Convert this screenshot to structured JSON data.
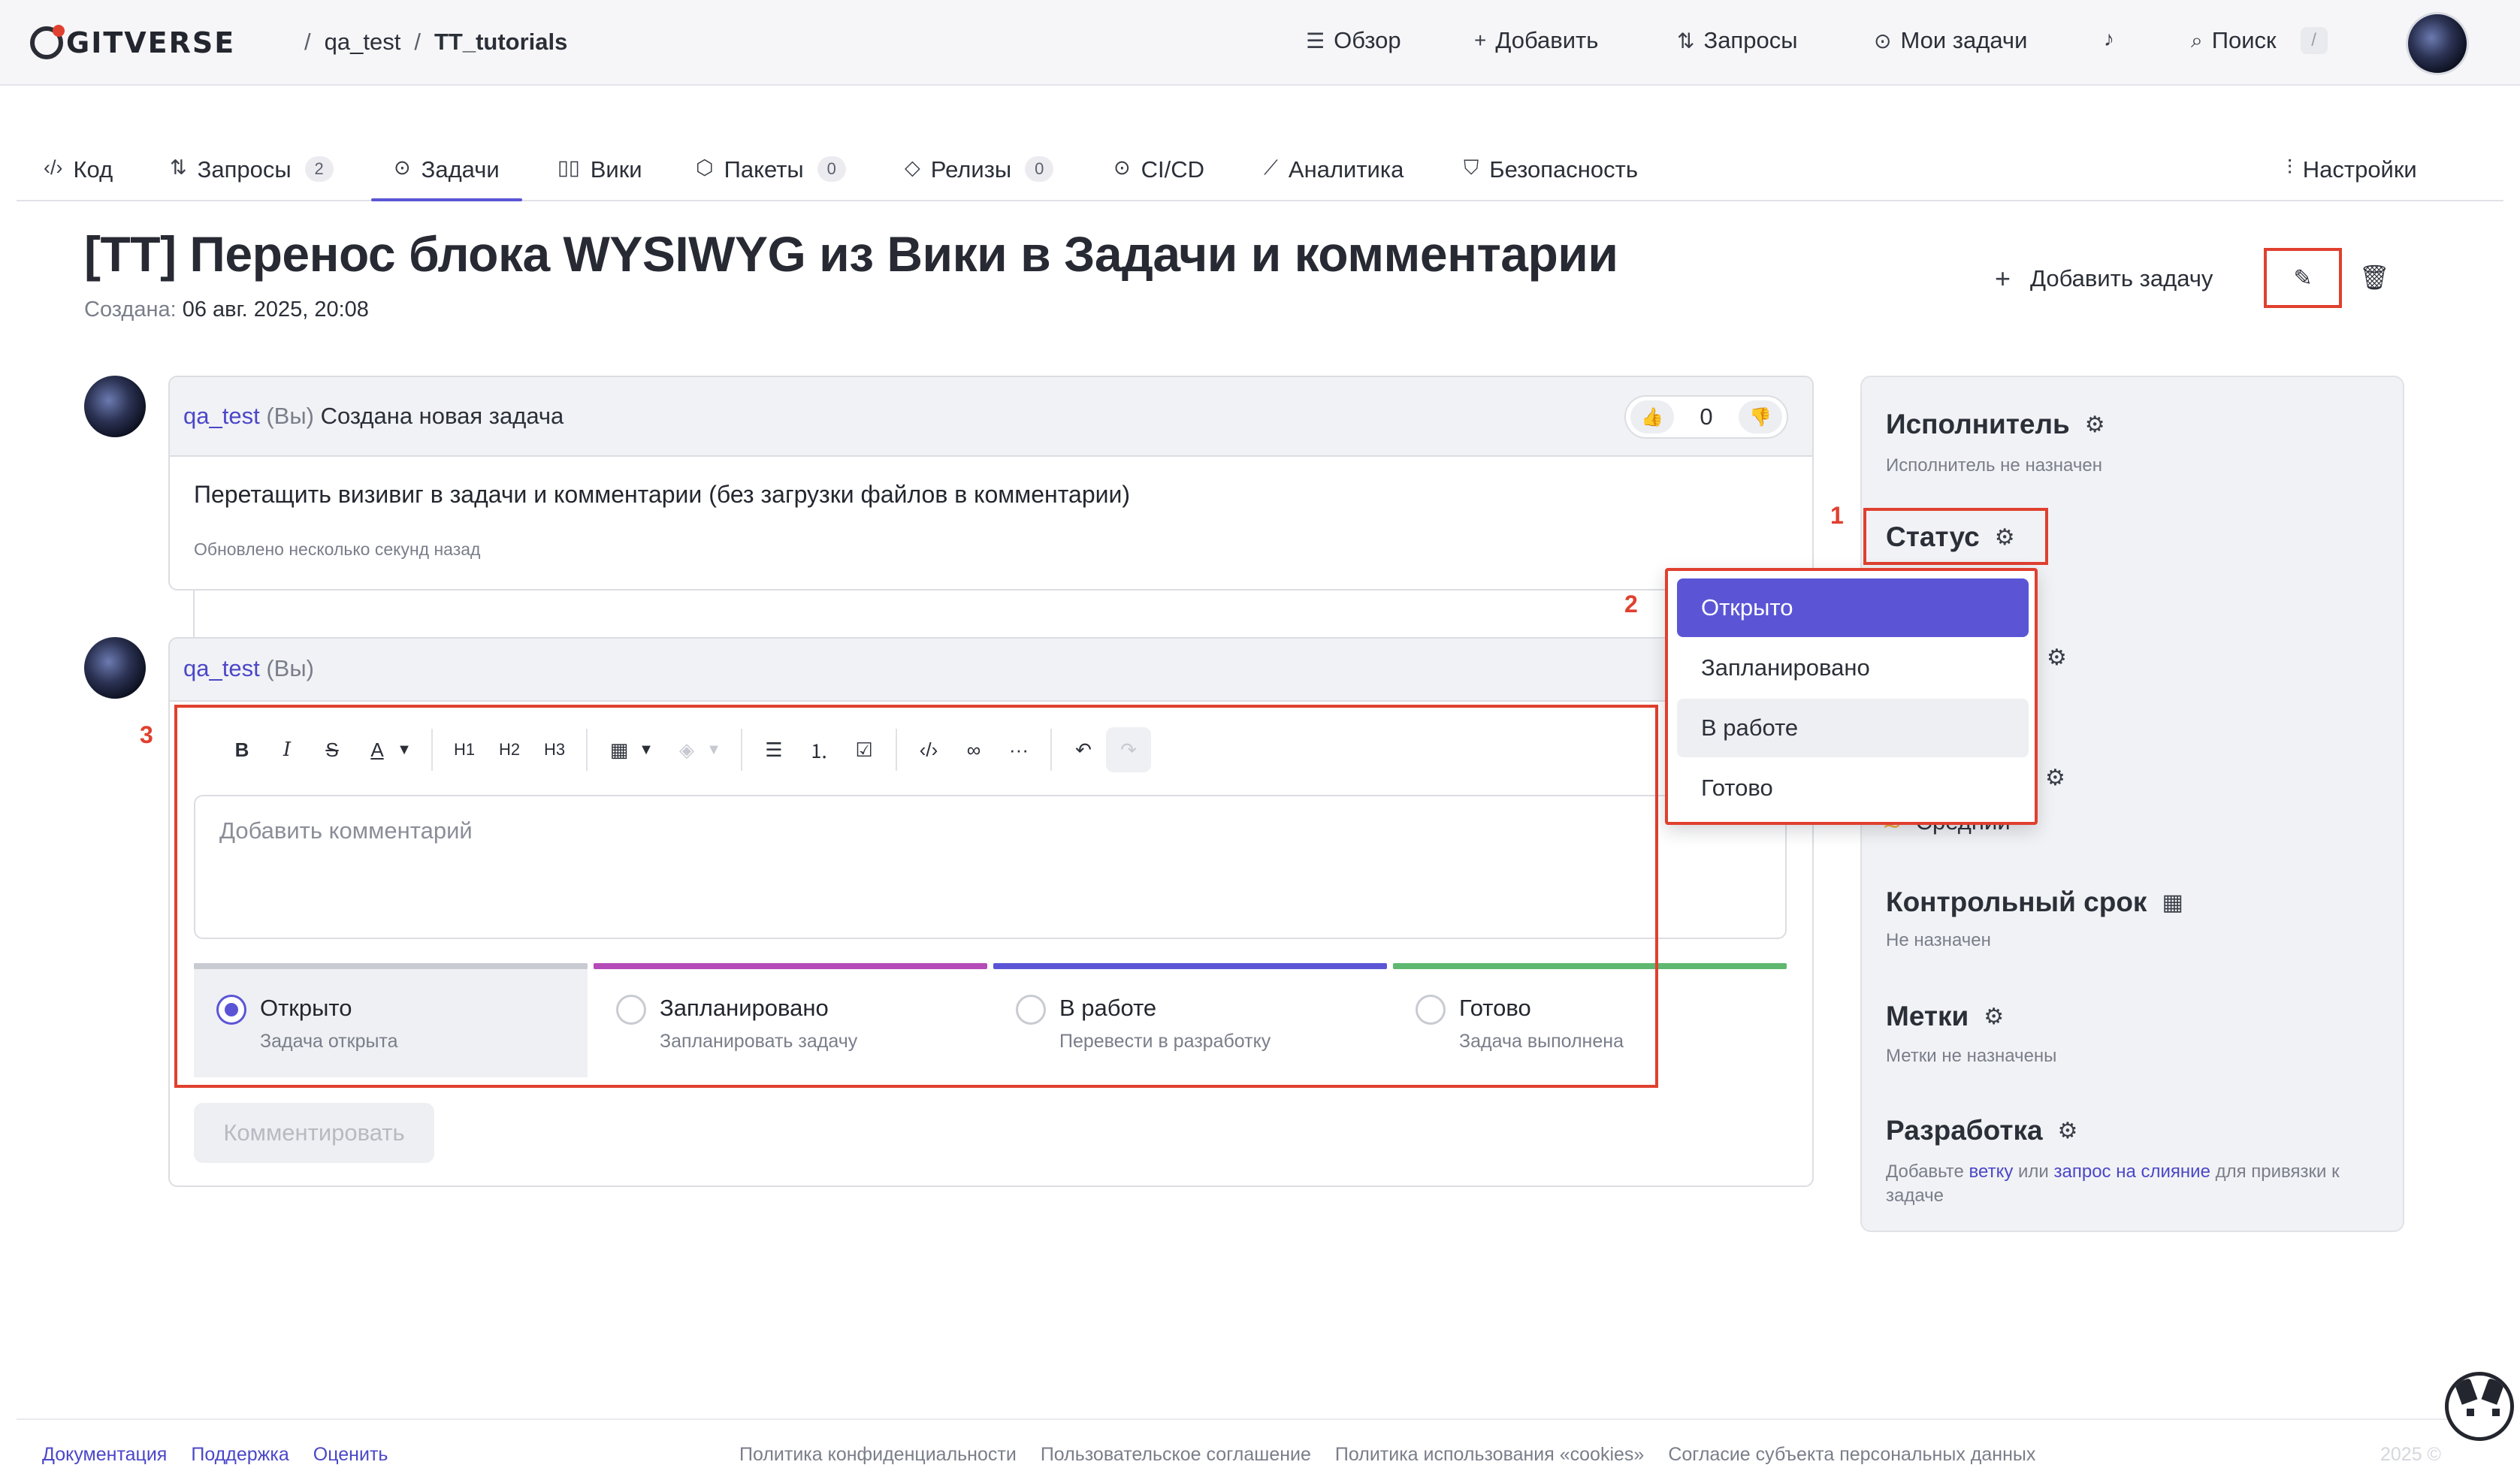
{
  "topbar": {
    "logo_text": "GITVERSE",
    "breadcrumb": {
      "owner": "qa_test",
      "separator": "/",
      "repo": "TT_tutorials"
    },
    "nav": {
      "overview": "Обзор",
      "add": "Добавить",
      "requests": "Запросы",
      "my_tasks": "Мои задачи",
      "search": "Поиск",
      "search_shortcut": "/"
    }
  },
  "tabs": [
    {
      "label": "Код",
      "icon": "code-icon"
    },
    {
      "label": "Запросы",
      "count": "2",
      "icon": "merge-icon"
    },
    {
      "label": "Задачи",
      "icon": "issue-icon",
      "active": true
    },
    {
      "label": "Вики",
      "icon": "book-icon"
    },
    {
      "label": "Пакеты",
      "count": "0",
      "icon": "package-icon"
    },
    {
      "label": "Релизы",
      "count": "0",
      "icon": "tag-icon"
    },
    {
      "label": "CI/CD",
      "icon": "ci-icon"
    },
    {
      "label": "Аналитика",
      "icon": "chart-icon"
    },
    {
      "label": "Безопасность",
      "icon": "shield-icon"
    },
    {
      "label": "Настройки",
      "icon": "settings-icon"
    }
  ],
  "issue": {
    "title": "[TT] Перенос блока WYSIWYG из Вики в Задачи и комментарии",
    "created_label": "Создана:",
    "created_value": "06 авг. 2025, 20:08",
    "add_task": "Добавить задачу"
  },
  "event": {
    "user": "qa_test",
    "you": "(Вы)",
    "action": "Создана новая задача",
    "reaction_count": "0",
    "body": "Перетащить визивиг в задачи и комментарии (без загрузки файлов в комментарии)",
    "updated": "Обновлено несколько секунд назад"
  },
  "composer": {
    "user": "qa_test",
    "you": "(Вы)",
    "placeholder": "Добавить комментарий",
    "submit": "Комментировать",
    "toolbar": {
      "bold": "B",
      "italic": "I",
      "strike": "S",
      "color": "A",
      "h1": "H1",
      "h2": "H2",
      "h3": "H3"
    },
    "statuses": [
      {
        "label": "Открыто",
        "desc": "Задача открыта",
        "color": "#c9cbd2",
        "selected": true
      },
      {
        "label": "Запланировано",
        "desc": "Запланировать задачу",
        "color": "#b54bb8"
      },
      {
        "label": "В работе",
        "desc": "Перевести в разработку",
        "color": "#5b55d6"
      },
      {
        "label": "Готово",
        "desc": "Задача выполнена",
        "color": "#5fb870"
      }
    ]
  },
  "sidebar": {
    "assignee_title": "Исполнитель",
    "assignee_value": "Исполнитель не назначен",
    "status_title": "Статус",
    "priority_value": "Средний",
    "deadline_title": "Контрольный срок",
    "deadline_value": "Не назначен",
    "labels_title": "Метки",
    "labels_value": "Метки не назначены",
    "dev_title": "Разработка",
    "dev_text_1": "Добавьте",
    "dev_link_branch": "ветку",
    "dev_text_2": "или",
    "dev_link_mr": "запрос на слияние",
    "dev_text_3": "для привязки к задаче"
  },
  "status_dropdown": {
    "options": [
      "Открыто",
      "Запланировано",
      "В работе",
      "Готово"
    ],
    "active_index": 0,
    "hover_index": 2
  },
  "annotations": {
    "one": "1",
    "two": "2",
    "three": "3"
  },
  "footer": {
    "links_left": [
      "Документация",
      "Поддержка",
      "Оценить"
    ],
    "links_mid": [
      "Политика конфиденциальности",
      "Пользовательское соглашение",
      "Политика использования «cookies»",
      "Согласие субъекта персональных данных"
    ],
    "copyright": "2025 ©"
  },
  "colors": {
    "accent": "#5b55d6",
    "annotation": "#e0402f",
    "link": "#4b47c8"
  }
}
